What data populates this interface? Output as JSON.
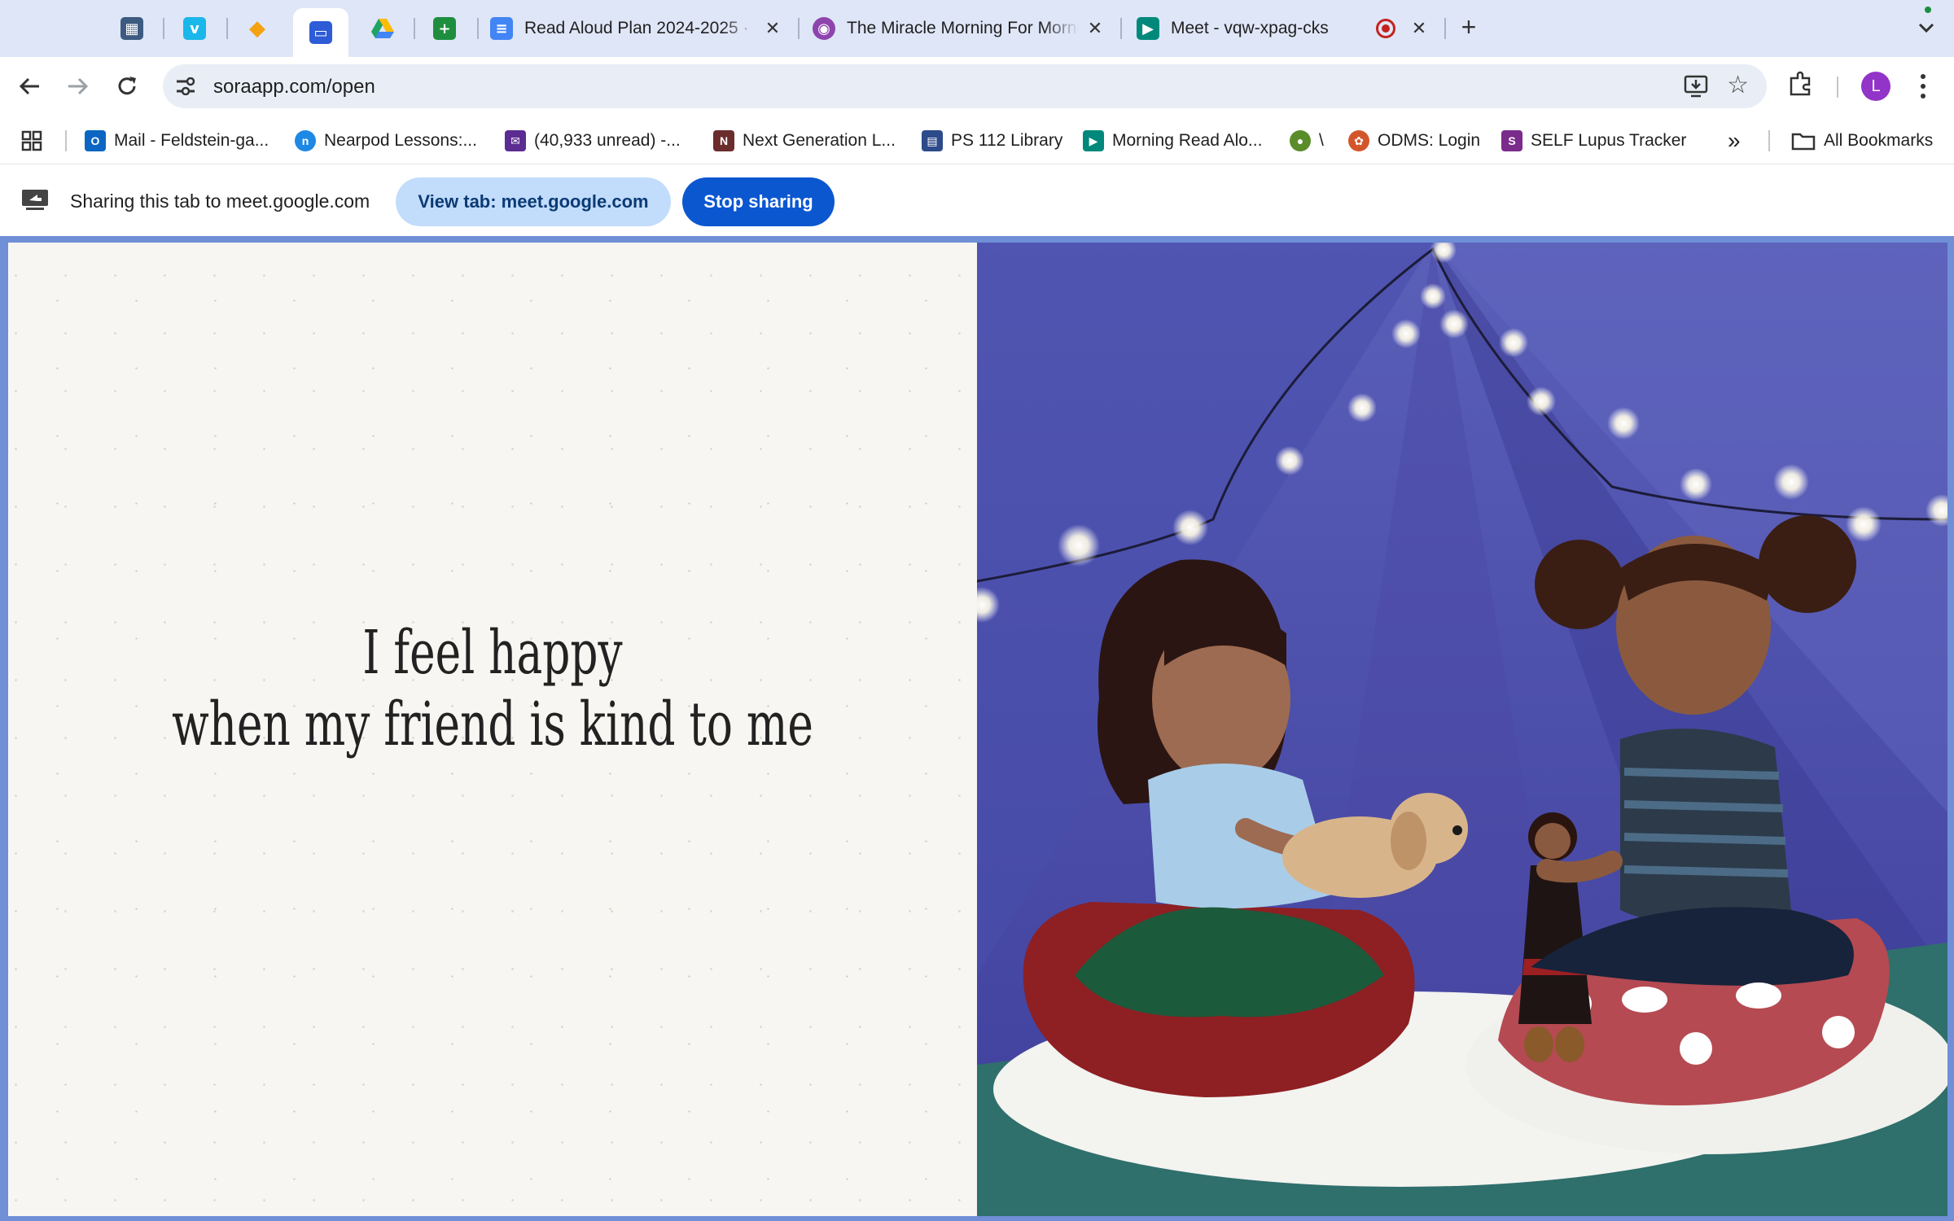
{
  "tabs": {
    "pinned": [
      {
        "name": "tab-pinned-calendar",
        "icon": "calendar-icon",
        "color": "#3d5a80",
        "glyph": "▦",
        "active": false
      },
      {
        "name": "tab-pinned-vimeo",
        "icon": "vimeo-icon",
        "color": "#1ab7ea",
        "glyph": "v",
        "active": false
      },
      {
        "name": "tab-pinned-app",
        "icon": "app-icon",
        "color": "#f4a20f",
        "glyph": "◆",
        "active": false
      },
      {
        "name": "tab-pinned-sora",
        "icon": "sora-icon",
        "color": "#2e5bd6",
        "glyph": "▭",
        "active": true
      },
      {
        "name": "tab-pinned-drive",
        "icon": "google-drive-icon",
        "color": "#1fa463",
        "glyph": "▲",
        "active": false
      },
      {
        "name": "tab-pinned-sheets",
        "icon": "google-sheets-icon",
        "color": "#1e8e3e",
        "glyph": "+",
        "active": false
      }
    ],
    "open": [
      {
        "title": "Read Aloud Plan 2024-2025 ·",
        "icon": "google-docs-icon",
        "color": "#4285f4"
      },
      {
        "title": "The Miracle Morning For Morning",
        "icon": "podcast-icon",
        "color": "#8e44ad"
      },
      {
        "title": "Meet - vqw-xpag-cks",
        "icon": "google-meet-icon",
        "color": "#00897b"
      }
    ],
    "recording_indicator": "recording-icon"
  },
  "toolbar": {
    "url": "soraapp.com/open",
    "avatar_letter": "L",
    "avatar_color": "#9334c8"
  },
  "bookmarks": {
    "items": [
      {
        "label": "Mail - Feldstein-ga...",
        "icon": "outlook-icon",
        "color": "#0a66c2"
      },
      {
        "label": "Nearpod Lessons:...",
        "icon": "nearpod-icon",
        "color": "#1e88e5"
      },
      {
        "label": "(40,933 unread) -...",
        "icon": "mail-icon",
        "color": "#5b2c91"
      },
      {
        "label": "Next Generation L...",
        "icon": "nysed-icon",
        "color": "#6b2c2c"
      },
      {
        "label": "PS 112 Library",
        "icon": "library-icon",
        "color": "#2d4a8a"
      },
      {
        "label": "Morning Read Alo...",
        "icon": "google-meet-icon",
        "color": "#00897b"
      },
      {
        "label": "\\",
        "icon": "frog-icon",
        "color": "#5b8c2a"
      },
      {
        "label": "ODMS: Login",
        "icon": "odms-icon",
        "color": "#d3562b"
      },
      {
        "label": "SELF Lupus Tracker",
        "icon": "self-icon",
        "color": "#7a2b8c"
      }
    ],
    "all_bookmarks": "All Bookmarks"
  },
  "sharebar": {
    "message": "Sharing this tab to meet.google.com",
    "view_tab": "View tab: meet.google.com",
    "stop": "Stop sharing"
  },
  "book": {
    "line1": "I feel happy",
    "line2": "when my friend is kind to me",
    "illustration": "two-girls-in-tent-illustration"
  }
}
